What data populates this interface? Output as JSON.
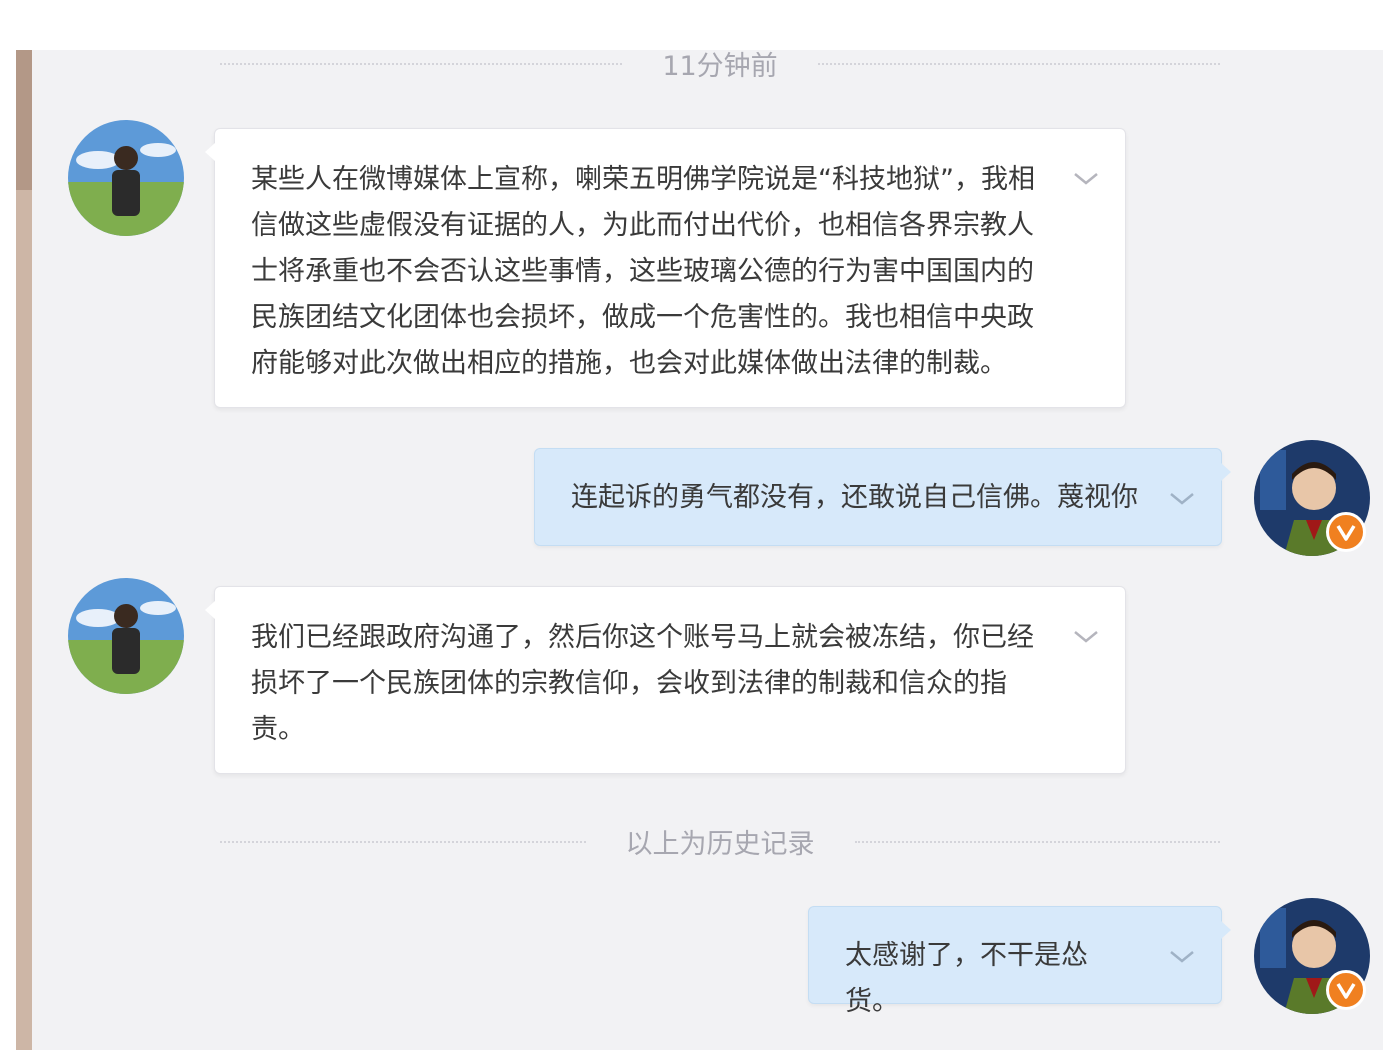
{
  "chat": {
    "timestamp_divider": "11分钟前",
    "history_divider": "以上为历史记录",
    "messages": [
      {
        "direction": "incoming",
        "text": "某些人在微博媒体上宣称，喇荣五明佛学院说是“科技地狱”，我相信做这些虚假没有证据的人，为此而付出代价，也相信各界宗教人士将承重也不会否认这些事情，这些玻璃公德的行为害中国国内的民族团结文化团体也会损坏，做成一个危害性的。我也相信中央政府能够对此次做出相应的措施，也会对此媒体做出法律的制裁。",
        "menu_icon": "chevron-down-icon"
      },
      {
        "direction": "outgoing",
        "text": "连起诉的勇气都没有，还敢说自己信佛。蔑视你",
        "menu_icon": "chevron-down-icon"
      },
      {
        "direction": "incoming",
        "text": "我们已经跟政府沟通了，然后你这个账号马上就会被冻结，你已经损坏了一个民族团体的宗教信仰，会收到法律的制裁和信众的指责。",
        "menu_icon": "chevron-down-icon"
      },
      {
        "direction": "outgoing",
        "text": "太感谢了，不干是怂货。",
        "menu_icon": "chevron-down-icon"
      }
    ]
  },
  "colors": {
    "panel_background": "#f2f2f4",
    "incoming_bubble": "#ffffff",
    "outgoing_bubble": "#d7e9fa",
    "verified_badge": "#f08020",
    "left_rail": "#cdb6a6"
  }
}
